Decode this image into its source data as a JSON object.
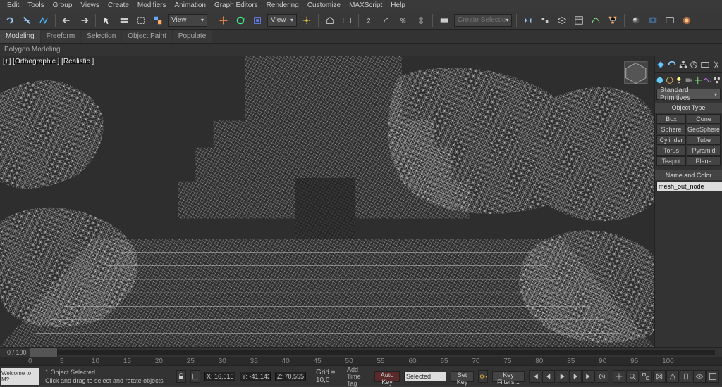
{
  "menu": [
    "Edit",
    "Tools",
    "Group",
    "Views",
    "Create",
    "Modifiers",
    "Animation",
    "Graph Editors",
    "Rendering",
    "Customize",
    "MAXScript",
    "Help"
  ],
  "quickdrop": {
    "selset": "View"
  },
  "ribbon_tabs": [
    "Modeling",
    "Freeform",
    "Selection",
    "Object Paint",
    "Populate"
  ],
  "ribbon_active": 0,
  "ribbon_sub": "Polygon Modeling",
  "viewport_label": "[+] [Orthographic ] [Realistic ]",
  "create_dropdown": "Standard Primitives",
  "rollouts": {
    "object_type": {
      "head": "Object Type",
      "buttons": [
        "Box",
        "Cone",
        "Sphere",
        "GeoSphere",
        "Cylinder",
        "Tube",
        "Torus",
        "Pyramid",
        "Teapot",
        "Plane"
      ]
    },
    "name_color": {
      "head": "Name and Color",
      "value": "mesh_out_node"
    }
  },
  "time": {
    "range": "0 / 100",
    "ticks": [
      "0",
      "5",
      "10",
      "15",
      "20",
      "25",
      "30",
      "35",
      "40",
      "45",
      "50",
      "55",
      "60",
      "65",
      "70",
      "75",
      "80",
      "85",
      "90",
      "95",
      "100"
    ]
  },
  "status": {
    "line1": "1 Object Selected",
    "line2": "Click and drag to select and rotate objects",
    "coords": {
      "x": "X: 16,015",
      "y": "Y: -41,143",
      "z": "Z: 70,555"
    },
    "grid": "Grid = 10,0",
    "autokey": "Auto Key",
    "setkey": "Set Key",
    "selected": "Selected",
    "keyfilters": "Key Filters...",
    "addtag": "Add Time Tag",
    "logo": "Welcome to M?"
  }
}
